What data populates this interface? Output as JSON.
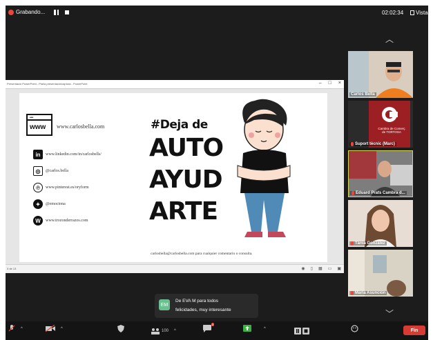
{
  "topbar": {
    "recording_label": "Grabando...",
    "timer": "02:02:34",
    "view_label": "Vista"
  },
  "shared_window": {
    "title": "Presentació PowerPoint - Pla/la presentació/captura - PowerPoint",
    "minimize": "–",
    "maximize": "□",
    "close": "×",
    "status_left": "3 de 13"
  },
  "slide": {
    "www_label": "www",
    "website": "www.carlosbella.com",
    "socials": [
      {
        "icon": "linkedin-icon",
        "glyph": "in",
        "text": "www.linkedin.com/in/carlosbells/"
      },
      {
        "icon": "instagram-icon",
        "glyph": "◎",
        "text": "@carlos.bella"
      },
      {
        "icon": "pinterest-icon",
        "glyph": "℗",
        "text": "www.pinterest.es/oryform"
      },
      {
        "icon": "twitter-icon",
        "glyph": "✦",
        "text": "@emociona"
      },
      {
        "icon": "wordpress-icon",
        "glyph": "W",
        "text": "www.trozonderrazos.com"
      }
    ],
    "hashtag": "#Deja de",
    "line1": "AUTO",
    "line2": "AYUD",
    "line3": "ARTE",
    "contact": "carlosbella@carlosbella.com  para cualquier comentario o consulta."
  },
  "participants": [
    {
      "name": "Carlos Bella",
      "muted": false
    },
    {
      "name": "Suport tècnic (Marc)",
      "muted": true,
      "logo_line1": "Cambra de Comerç",
      "logo_line2": "de TORTOSA"
    },
    {
      "name": "Eduard Prats Cambra d...",
      "muted": true
    },
    {
      "name": "Tània González",
      "muted": true
    },
    {
      "name": "Maria Asunción",
      "muted": true
    }
  ],
  "chat_notification": {
    "avatar": "EM",
    "from": "De EVA M para todos",
    "message": "felicidades, muy interesante"
  },
  "toolbar": {
    "participants_count": "100",
    "chat_badge": "3",
    "end_label": "Fin",
    "items": [
      {
        "icon": "microphone-icon",
        "label": "Audio"
      },
      {
        "icon": "video-off-icon",
        "label": "Video"
      },
      {
        "icon": "security-icon",
        "label": "Seguridad"
      },
      {
        "icon": "participants-icon",
        "label": "Participantes"
      },
      {
        "icon": "chat-icon",
        "label": "Chat"
      },
      {
        "icon": "share-screen-icon",
        "label": "Compartir"
      },
      {
        "icon": "record-icon",
        "label": "Grabar"
      },
      {
        "icon": "reactions-icon",
        "label": "Reacciones"
      }
    ]
  },
  "colors": {
    "record": "#e8483c",
    "end": "#d63c33",
    "chat_avatar": "#6bbf8f",
    "share": "#3cb043"
  }
}
